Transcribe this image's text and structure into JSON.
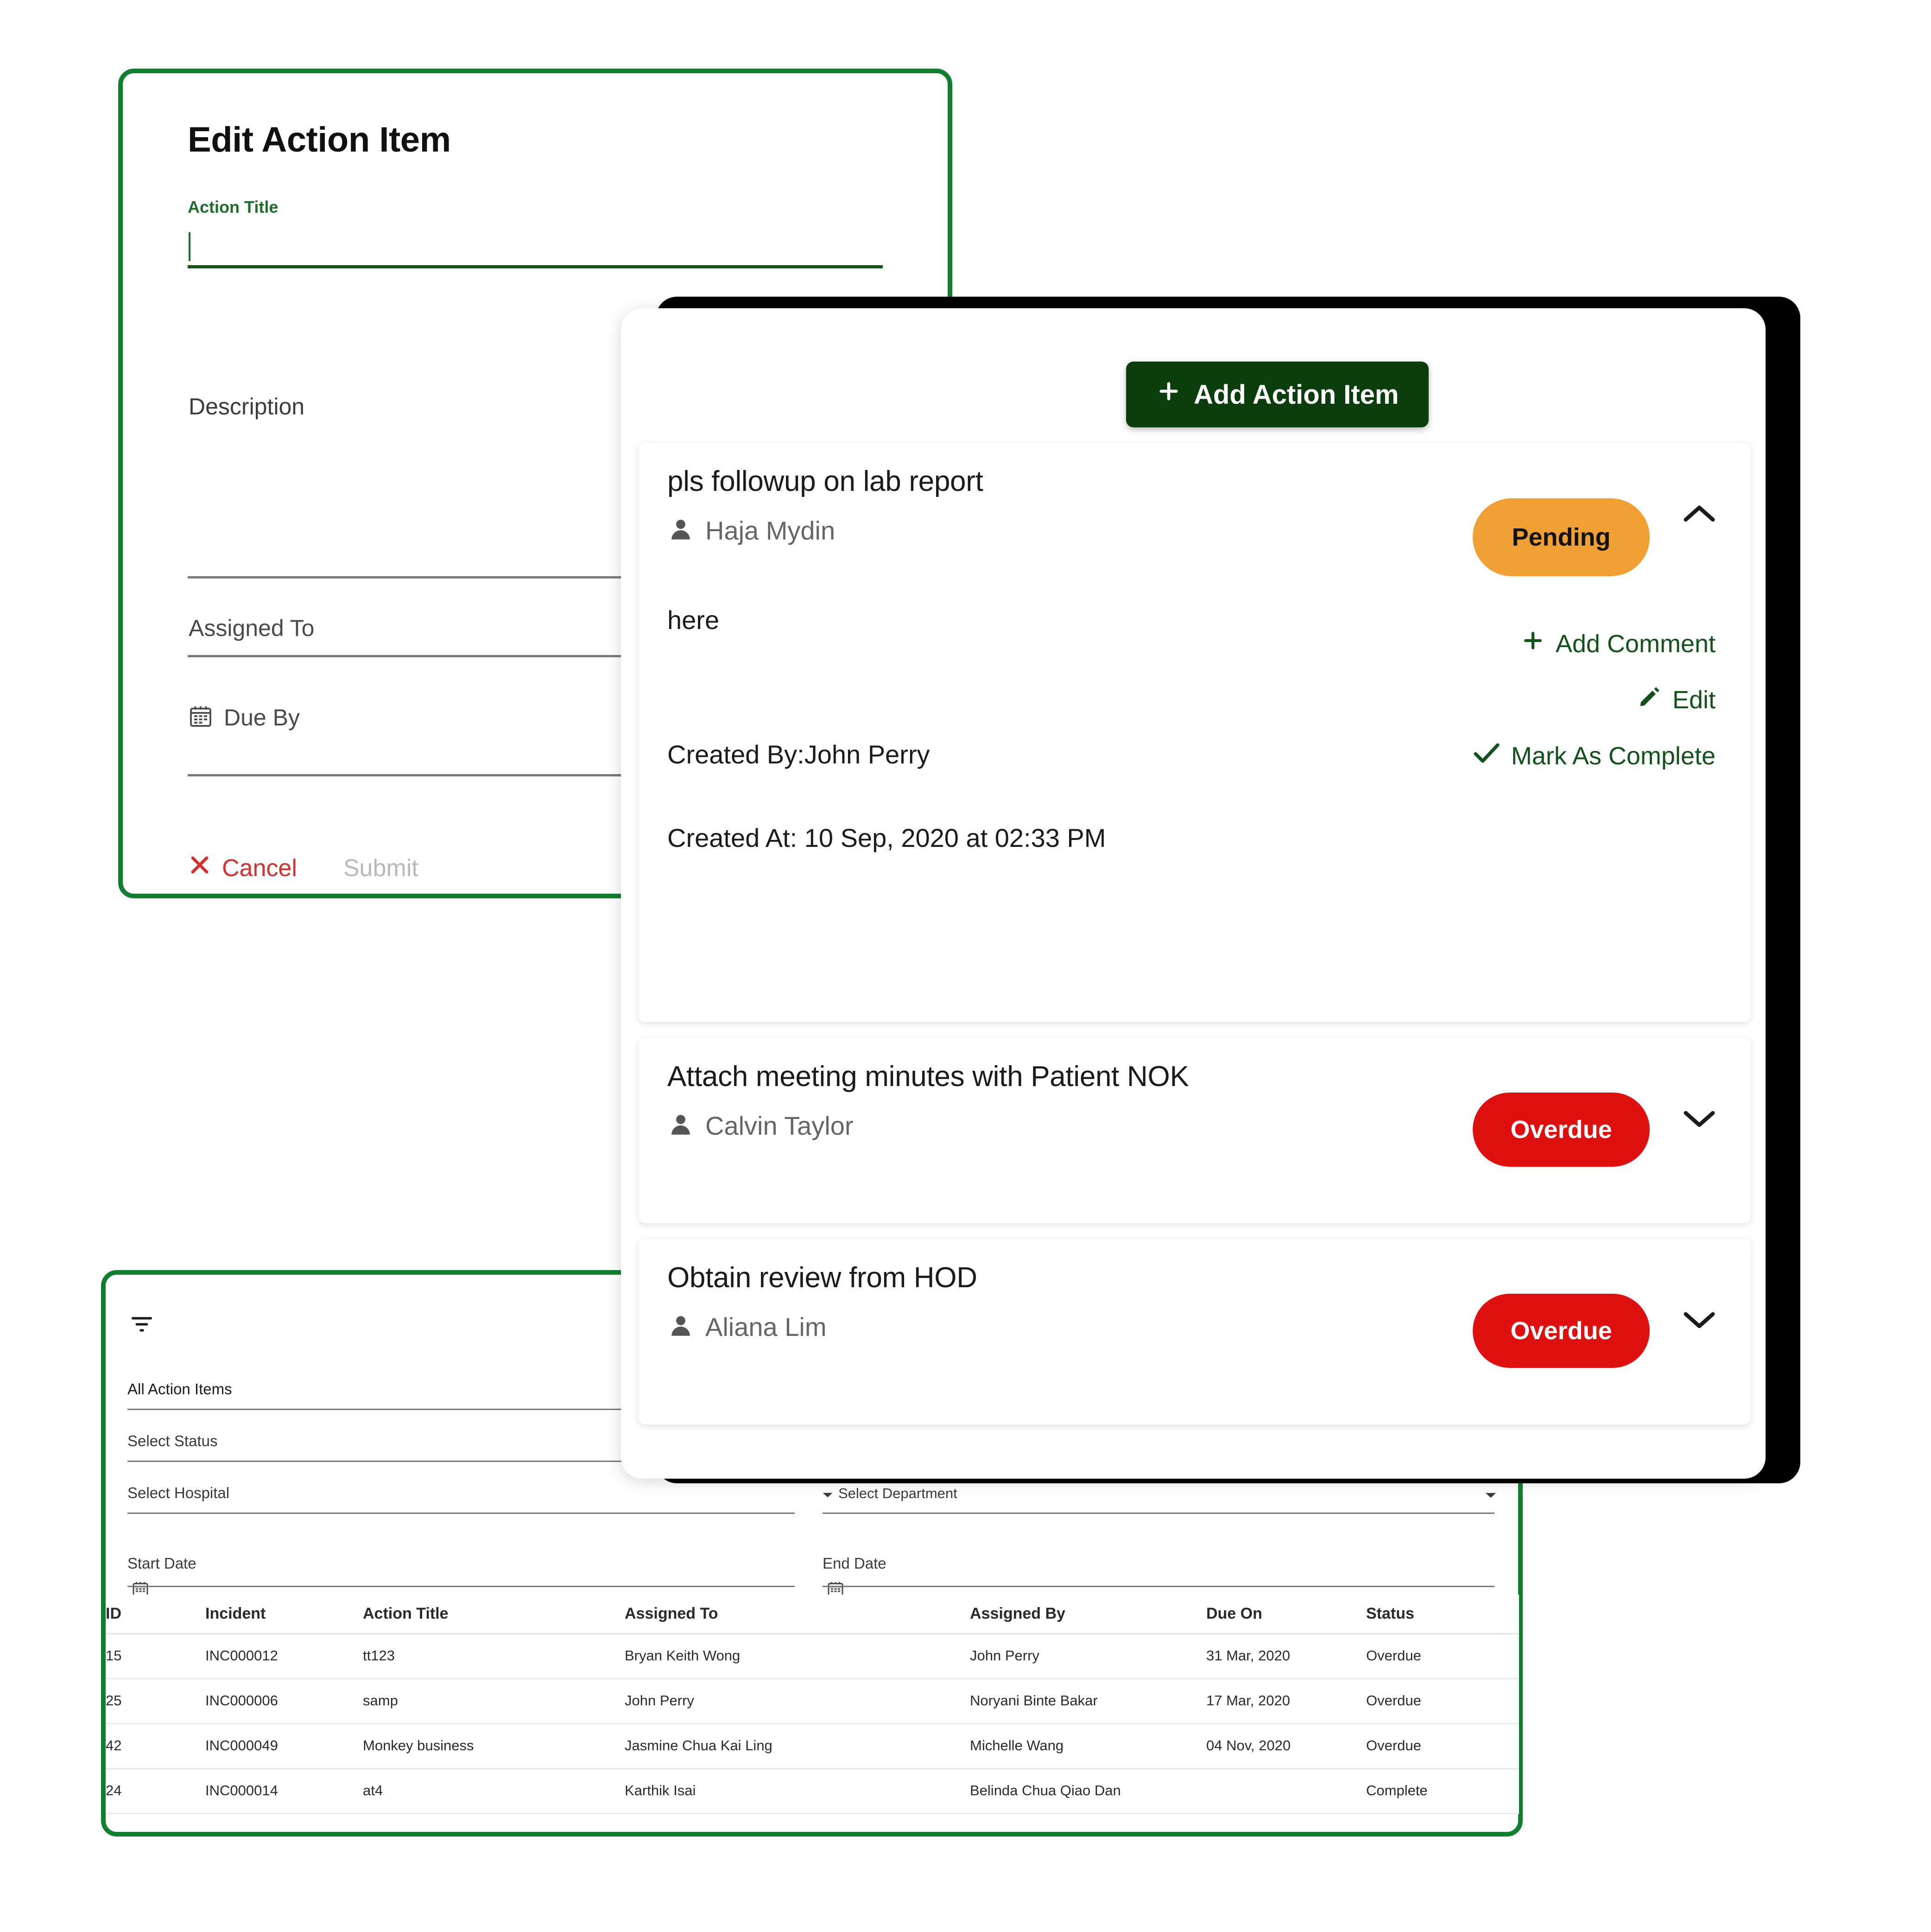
{
  "edit_panel": {
    "title": "Edit Action Item",
    "action_title_label": "Action Title",
    "action_title_value": "",
    "description_label": "Description",
    "description_value": "",
    "assigned_to_label": "Assigned To",
    "assigned_to_value": "",
    "due_by_label": "Due By",
    "due_by_value": "",
    "cancel_label": "Cancel",
    "submit_label": "Submit"
  },
  "main_panel": {
    "add_button_label": "Add Action Item",
    "items": [
      {
        "title": "pls followup on lab report",
        "assignee": "Haja Mydin",
        "status": "Pending",
        "status_color": "#F0A032",
        "expanded": true,
        "body": "here",
        "created_by": "Created By:John Perry",
        "created_at": "Created At: 10 Sep, 2020 at 02:33 PM",
        "links": {
          "add_comment": "Add Comment",
          "edit": "Edit",
          "mark_complete": "Mark As Complete"
        }
      },
      {
        "title": "Attach meeting minutes with Patient NOK",
        "assignee": "Calvin Taylor",
        "status": "Overdue",
        "status_color": "#DE1010",
        "expanded": false
      },
      {
        "title": "Obtain review from HOD",
        "assignee": "Aliana Lim",
        "status": "Overdue",
        "status_color": "#DE1010",
        "expanded": false
      }
    ]
  },
  "table_panel": {
    "filters": {
      "all_action_items": "All Action Items",
      "select_status": "Select Status",
      "select_hospital": "Select Hospital",
      "select_department": "Select Department",
      "start_date": "Start Date",
      "end_date": "End Date"
    },
    "columns": [
      "ID",
      "Incident",
      "Action Title",
      "Assigned To",
      "Assigned By",
      "Due On",
      "Status"
    ],
    "rows": [
      {
        "id": "15",
        "incident": "INC000012",
        "action_title": "tt123",
        "assigned_to": "Bryan Keith Wong",
        "assigned_by": "John Perry",
        "due_on": "31 Mar, 2020",
        "status": "Overdue"
      },
      {
        "id": "25",
        "incident": "INC000006",
        "action_title": "samp",
        "assigned_to": "John Perry",
        "assigned_by": "Noryani Binte Bakar",
        "due_on": "17 Mar, 2020",
        "status": "Overdue"
      },
      {
        "id": "42",
        "incident": "INC000049",
        "action_title": "Monkey business",
        "assigned_to": "Jasmine Chua Kai Ling",
        "assigned_by": "Michelle Wang",
        "due_on": "04 Nov, 2020",
        "status": "Overdue"
      },
      {
        "id": "24",
        "incident": "INC000014",
        "action_title": "at4",
        "assigned_to": "Karthik Isai",
        "assigned_by": "Belinda Chua Qiao Dan",
        "due_on": "",
        "status": "Complete"
      }
    ]
  },
  "theme": {
    "brand_green": "#108030",
    "dark_green": "#0c3d0c",
    "link_green": "#13521b",
    "cancel_red": "#d32f2f",
    "overdue_red": "#DE1010",
    "pending_orange": "#F0A032"
  }
}
